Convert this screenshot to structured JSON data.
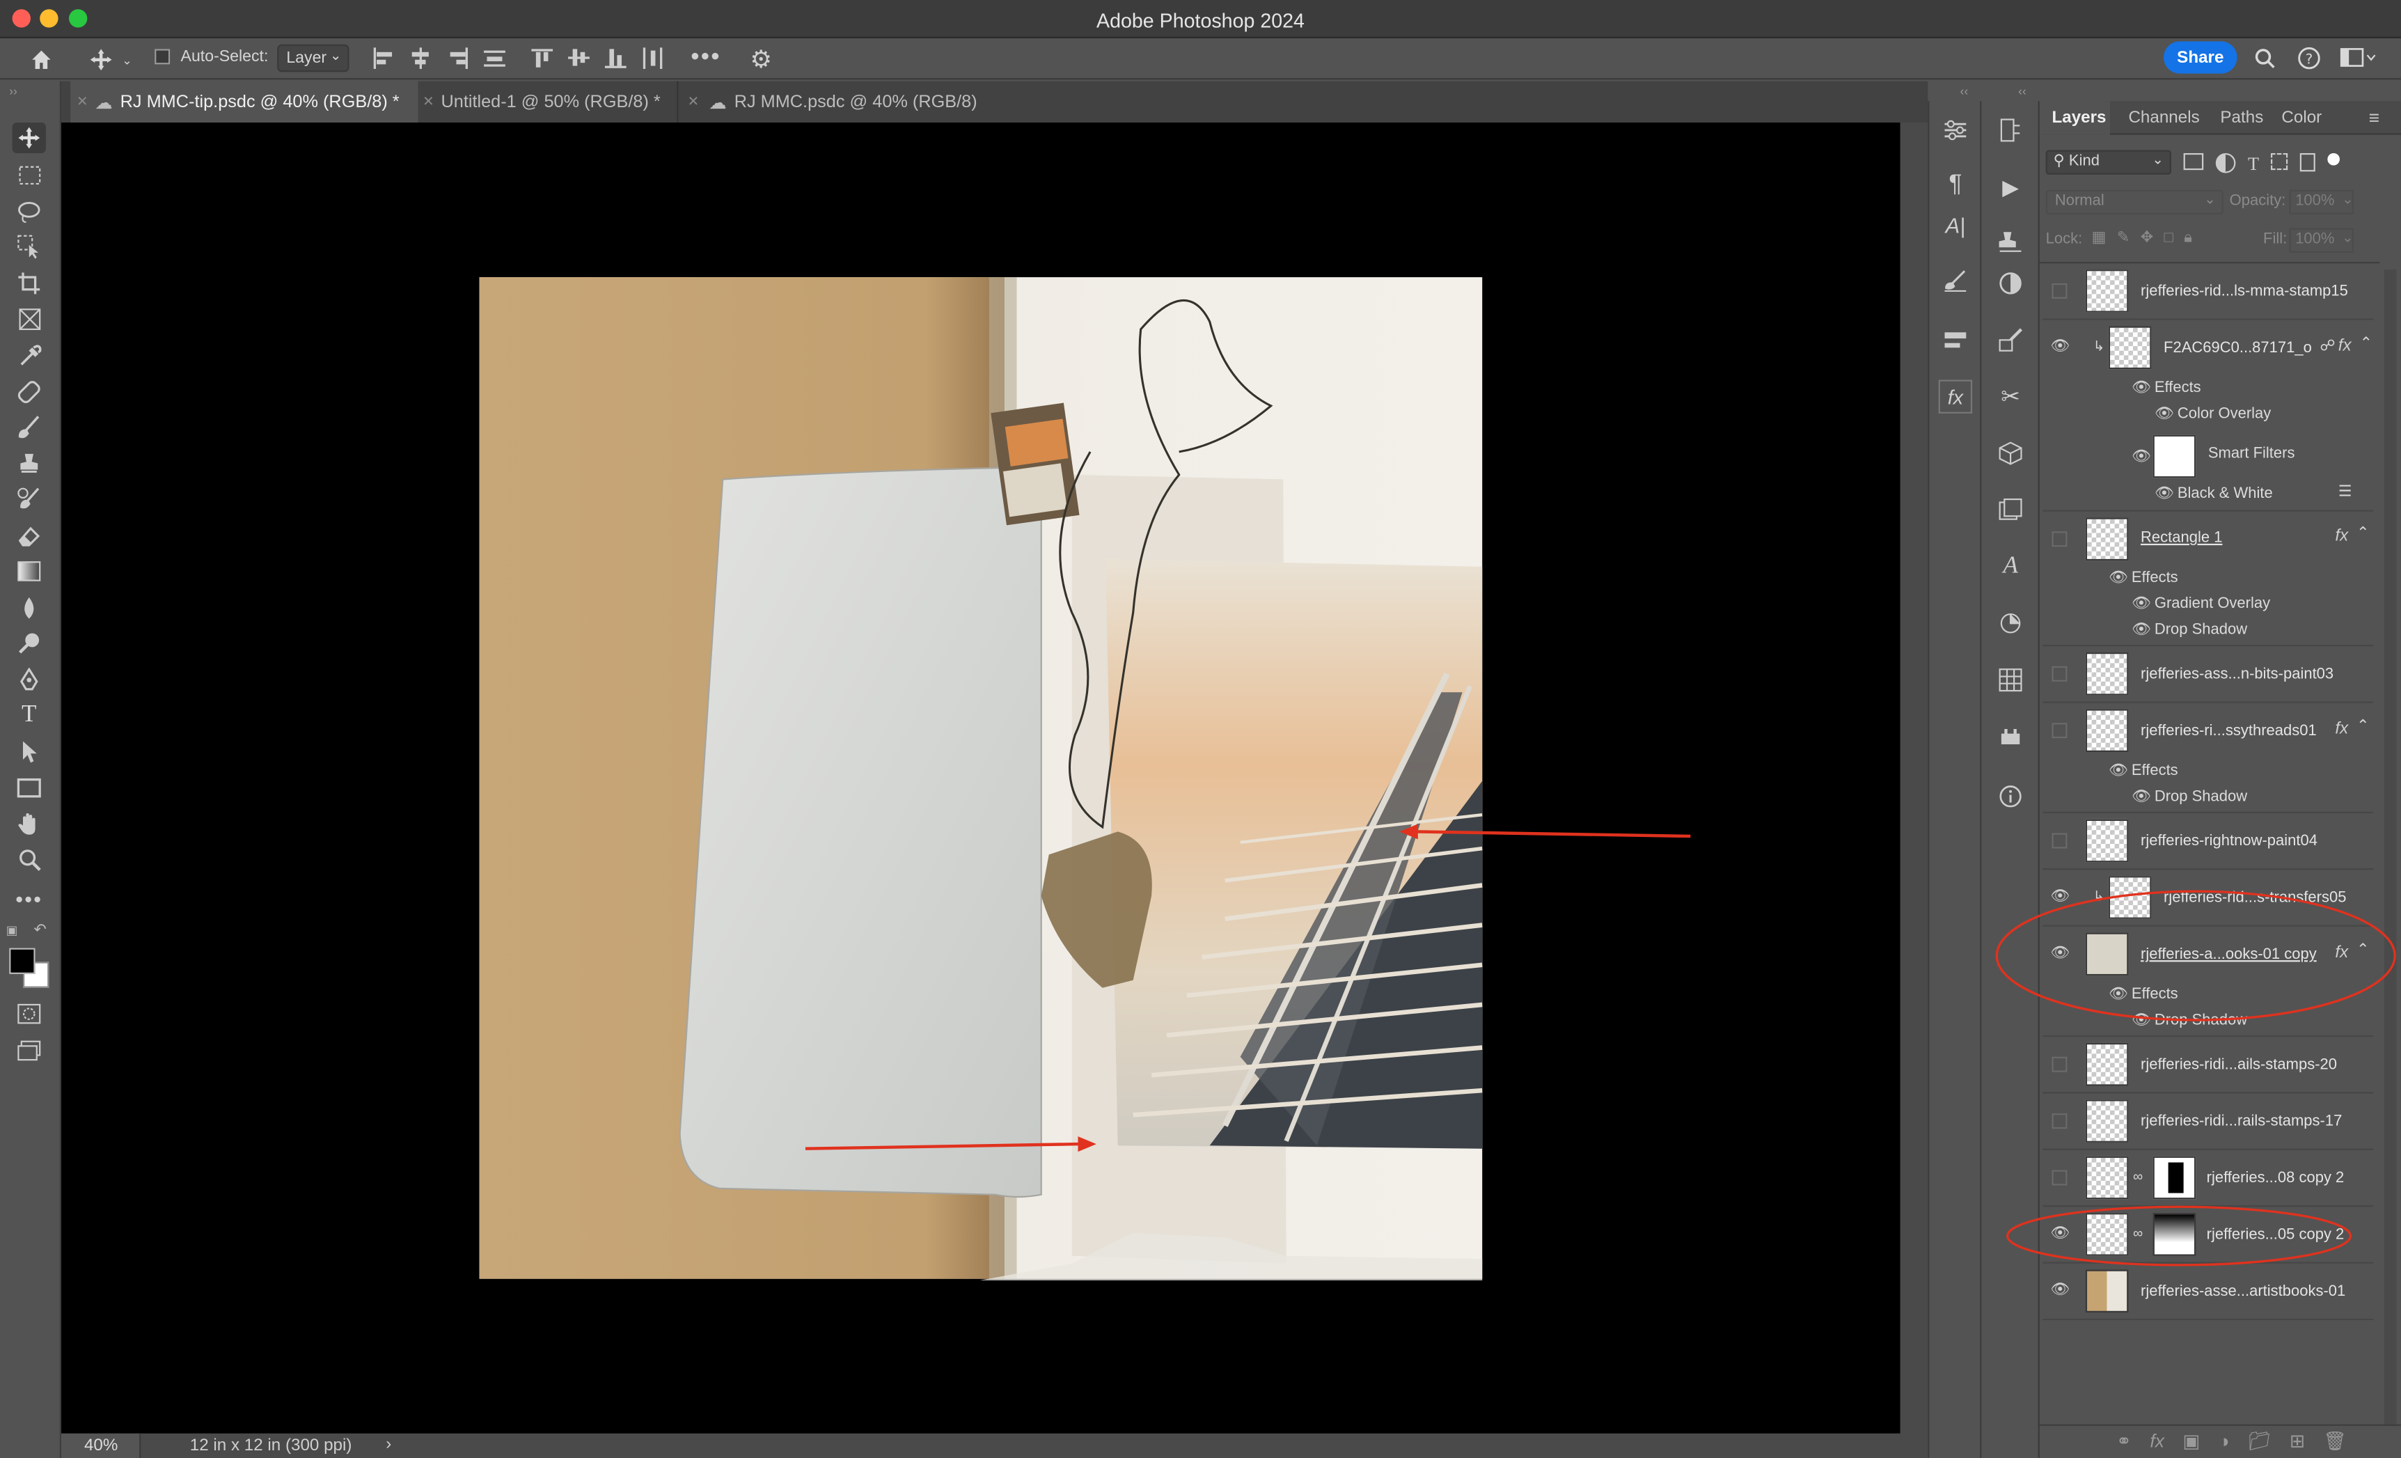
{
  "app": {
    "title": "Adobe Photoshop 2024"
  },
  "options_bar": {
    "auto_select_label": "Auto-Select:",
    "auto_select_checked": false,
    "auto_select_target": "Layer",
    "share_label": "Share"
  },
  "tabs": [
    {
      "label": "RJ MMC-tip.psdc @ 40% (RGB/8) *",
      "active": true,
      "cloud": true
    },
    {
      "label": "Untitled-1 @ 50% (RGB/8) *",
      "active": false,
      "cloud": false
    },
    {
      "label": "RJ MMC.psdc @ 40% (RGB/8)",
      "active": false,
      "cloud": true
    }
  ],
  "status_bar": {
    "zoom": "40%",
    "doc_size": "12 in x 12 in (300 ppi)"
  },
  "panel": {
    "tabs": [
      "Layers",
      "Channels",
      "Paths",
      "Color"
    ],
    "active_tab": "Layers",
    "filter_kind": "Kind",
    "blend_mode": "Normal",
    "opacity_label": "Opacity:",
    "opacity_value": "100%",
    "lock_label": "Lock:",
    "fill_label": "Fill:",
    "fill_value": "100%"
  },
  "layers": {
    "l1": {
      "name": "rjefferies-rid...ls-mma-stamp15",
      "visible": false
    },
    "l2": {
      "name": "F2AC69C0...87171_o",
      "visible": true,
      "effects": "Effects",
      "effect_1": "Color Overlay",
      "smart_filters": "Smart Filters",
      "filter_1": "Black & White"
    },
    "l3": {
      "name": "Rectangle 1",
      "visible": false,
      "effects": "Effects",
      "effect_1": "Gradient Overlay",
      "effect_2": "Drop Shadow"
    },
    "l4": {
      "name": "rjefferies-ass...n-bits-paint03",
      "visible": false
    },
    "l5": {
      "name": "rjefferies-ri...ssythreads01",
      "visible": false,
      "effects": "Effects",
      "effect_1": "Drop Shadow"
    },
    "l6": {
      "name": "rjefferies-rightnow-paint04",
      "visible": false
    },
    "l7": {
      "name": "rjefferies-rid...s-transfers05",
      "visible": true
    },
    "l8": {
      "name": "rjefferies-a...ooks-01 copy",
      "visible": true,
      "effects": "Effects",
      "effect_1": "Drop Shadow"
    },
    "l9": {
      "name": "rjefferies-ridi...ails-stamps-20",
      "visible": false
    },
    "l10": {
      "name": "rjefferies-ridi...rails-stamps-17",
      "visible": false
    },
    "l11": {
      "name": "rjefferies...08 copy 2",
      "visible": false
    },
    "l12": {
      "name": "rjefferies...05 copy 2",
      "visible": true
    },
    "l13": {
      "name": "rjefferies-asse...artistbooks-01",
      "visible": true
    }
  },
  "colors": {
    "share": "#1473e6",
    "annotation": "#e0321e",
    "kraft": "#c8a877",
    "panel_bg": "#535353",
    "canvas_bg": "#000000"
  }
}
